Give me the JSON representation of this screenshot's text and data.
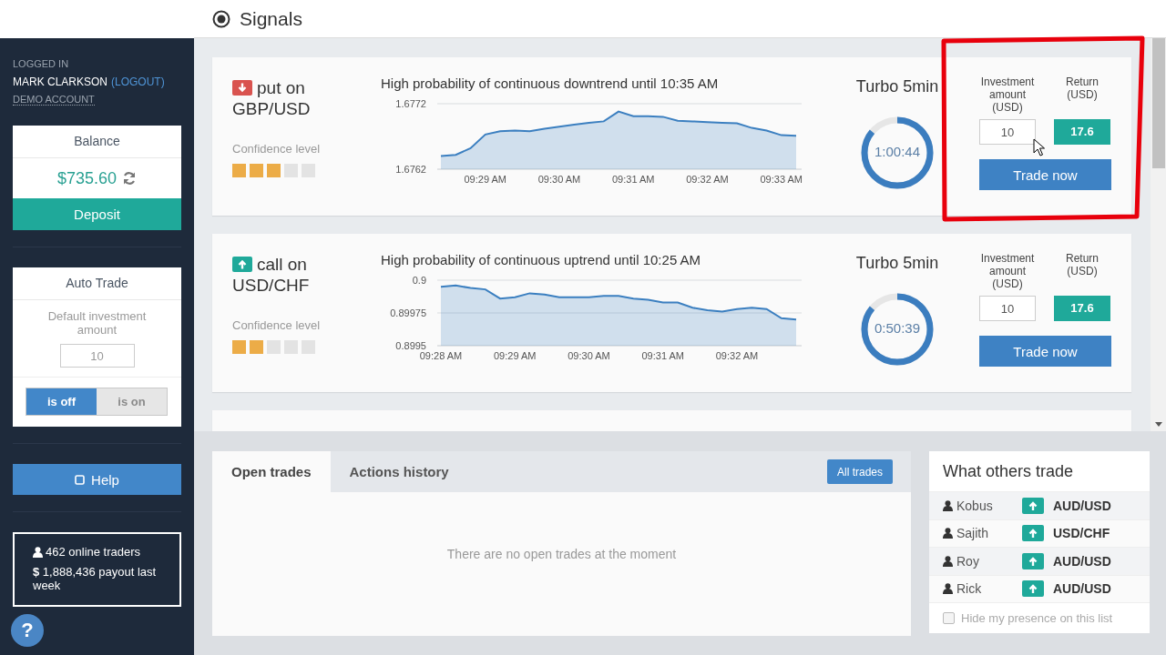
{
  "sidebar": {
    "logged_in_label": "LOGGED IN",
    "user_name": "MARK CLARKSON",
    "logout_link": "(LOGOUT)",
    "account_type": "DEMO ACCOUNT",
    "balance": {
      "title": "Balance",
      "amount": "$735.60",
      "deposit_button": "Deposit"
    },
    "auto_trade": {
      "title": "Auto Trade",
      "label": "Default investment amount",
      "amount": "10",
      "toggle": [
        {
          "label": "is off",
          "selected": true
        },
        {
          "label": "is on",
          "selected": false
        }
      ]
    },
    "help_button": "Help",
    "stats": {
      "online_traders": "462 online traders",
      "payout": "**$** 1,888,436 payout last week"
    },
    "help_bubble": "?"
  },
  "page_title": "Signals",
  "signals": [
    {
      "kind": "put",
      "title": "put on",
      "pair": "GBP/USD",
      "confidence_label": "Confidence level",
      "stars": 3,
      "forecast": "High probability of continuous downtrend until 10:35 AM",
      "chart_data": {
        "type": "area",
        "categories": [
          null,
          null,
          null,
          "09:29 AM",
          null,
          null,
          null,
          null,
          "09:30 AM",
          null,
          null,
          null,
          null,
          "09:31 AM",
          null,
          null,
          null,
          null,
          "09:32 AM",
          null,
          null,
          null,
          null,
          "09:33 AM",
          null
        ],
        "series": [
          {
            "color": "#3b7fc0",
            "values": [
              1.6764,
              1.67642,
              1.67652,
              1.67673,
              1.67678,
              1.67679,
              1.67678,
              1.67682,
              1.67685,
              1.67688,
              1.67691,
              1.67693,
              1.67708,
              1.67701,
              1.67701,
              1.677,
              1.67694,
              1.67693,
              1.67692,
              1.67691,
              1.6769,
              1.67683,
              1.67679,
              1.67672,
              1.67671
            ]
          }
        ],
        "ylim": [
          1.6762,
          1.6772
        ],
        "yticks": [
          1.6762,
          1.6772
        ]
      },
      "expiry": "Turbo 5min",
      "timer": "1:00:44",
      "level": 0.86,
      "investment_label": "Investment amount (USD)",
      "return_label": "Return (USD)",
      "investment": "10",
      "return": "17.6",
      "trade_button": "Trade now"
    },
    {
      "kind": "call",
      "title": "call on",
      "pair": "USD/CHF",
      "confidence_label": "Confidence level",
      "stars": 2,
      "forecast": "High probability of continuous uptrend until 10:25 AM",
      "chart_data": {
        "type": "area",
        "categories": [
          "09:28 AM",
          null,
          null,
          null,
          null,
          "09:29 AM",
          null,
          null,
          null,
          null,
          "09:30 AM",
          null,
          null,
          null,
          null,
          "09:31 AM",
          null,
          null,
          null,
          null,
          "09:32 AM",
          null,
          null,
          null,
          null
        ],
        "series": [
          {
            "color": "#3b7fc0",
            "values": [
              0.89995,
              0.89996,
              0.89994,
              0.89993,
              0.89986,
              0.89987,
              0.8999,
              0.89989,
              0.89987,
              0.89987,
              0.89987,
              0.89988,
              0.89988,
              0.89986,
              0.89985,
              0.89983,
              0.89983,
              0.89979,
              0.89977,
              0.89976,
              0.89978,
              0.89979,
              0.89978,
              0.89971,
              0.8997
            ]
          }
        ],
        "ylim": [
          0.8995,
          0.9
        ],
        "yticks": [
          0.8995,
          0.89975,
          0.9
        ]
      },
      "expiry": "Turbo 5min",
      "timer": "0:50:39",
      "level": 0.86,
      "investment_label": "Investment amount (USD)",
      "return_label": "Return (USD)",
      "investment": "10",
      "return": "17.6",
      "trade_button": "Trade now"
    }
  ],
  "trades_panel": {
    "tabs": [
      {
        "label": "Open trades",
        "selected": true
      },
      {
        "label": "Actions history",
        "selected": false
      }
    ],
    "all_trades_button": "All trades",
    "empty_message": "There are no open trades at the moment"
  },
  "others": {
    "title": "What others trade",
    "rows": [
      {
        "name": "Kobus",
        "kind": "call",
        "pair": "AUD/USD"
      },
      {
        "name": "Sajith",
        "kind": "call",
        "pair": "USD/CHF"
      },
      {
        "name": "Roy",
        "kind": "call",
        "pair": "AUD/USD"
      },
      {
        "name": "Rick",
        "kind": "call",
        "pair": "AUD/USD"
      }
    ],
    "hide_presence": {
      "label": "Hide my presence on this list",
      "checked": false
    }
  }
}
